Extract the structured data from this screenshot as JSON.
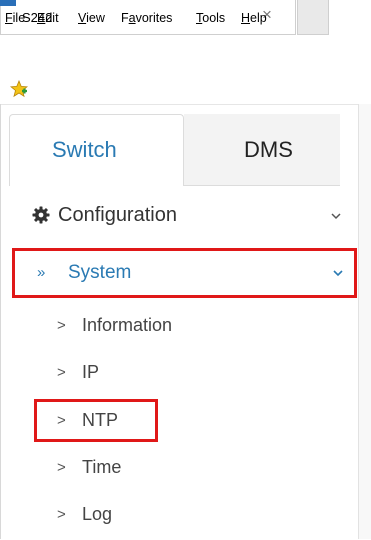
{
  "browser": {
    "tab_title": "S242",
    "tab_close": "×",
    "menu": [
      {
        "mnemonic": "F",
        "rest": "ile"
      },
      {
        "mnemonic": "E",
        "rest": "dit"
      },
      {
        "mnemonic": "V",
        "rest": "iew"
      },
      {
        "pre": "F",
        "mnemonic": "a",
        "rest": "vorites"
      },
      {
        "mnemonic": "T",
        "rest": "ools"
      },
      {
        "mnemonic": "H",
        "rest": "elp"
      }
    ]
  },
  "tabs": {
    "switch_label": "Switch",
    "dms_label": "DMS",
    "active": "Switch"
  },
  "nav": {
    "configuration_label": "Configuration",
    "system_arrows": "»",
    "system_label": "System",
    "sub_chevron": ">",
    "items": [
      {
        "label": "Information"
      },
      {
        "label": "IP"
      },
      {
        "label": "NTP"
      },
      {
        "label": "Time"
      },
      {
        "label": "Log"
      }
    ]
  },
  "colors": {
    "accent": "#2a7ab3",
    "highlight_box": "#e01818"
  }
}
